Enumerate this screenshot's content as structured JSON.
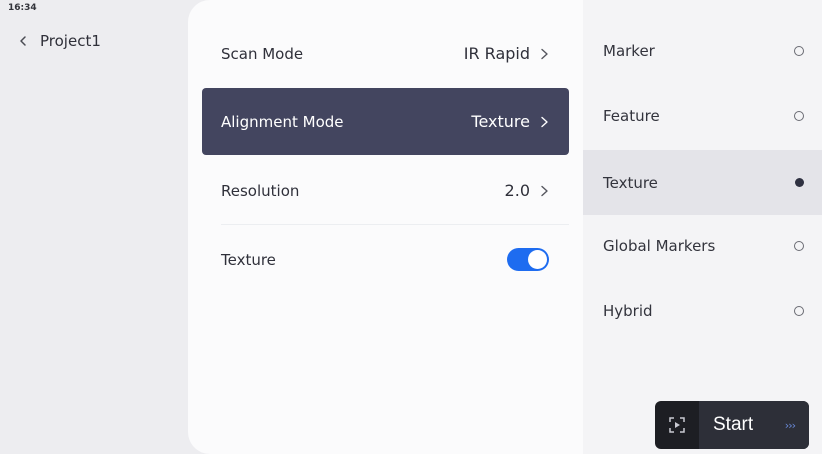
{
  "status": {
    "time": "16:34"
  },
  "nav": {
    "back_label": "Project1"
  },
  "settings": {
    "rows": [
      {
        "label": "Scan Mode",
        "value": "IR Rapid"
      },
      {
        "label": "Alignment Mode",
        "value": "Texture"
      },
      {
        "label": "Resolution",
        "value": "2.0"
      },
      {
        "label": "Texture",
        "toggle_on": true
      }
    ]
  },
  "alignment_options": {
    "items": [
      {
        "label": "Marker",
        "selected": false
      },
      {
        "label": "Feature",
        "selected": false
      },
      {
        "label": "Texture",
        "selected": true
      },
      {
        "label": "Global Markers",
        "selected": false
      },
      {
        "label": "Hybrid",
        "selected": false
      }
    ]
  },
  "actions": {
    "start_label": "Start",
    "start_arrows": "›››"
  },
  "colors": {
    "accent": "#1e6cf0",
    "active_row": "#43455f",
    "start_bar": "#1d1e23"
  }
}
